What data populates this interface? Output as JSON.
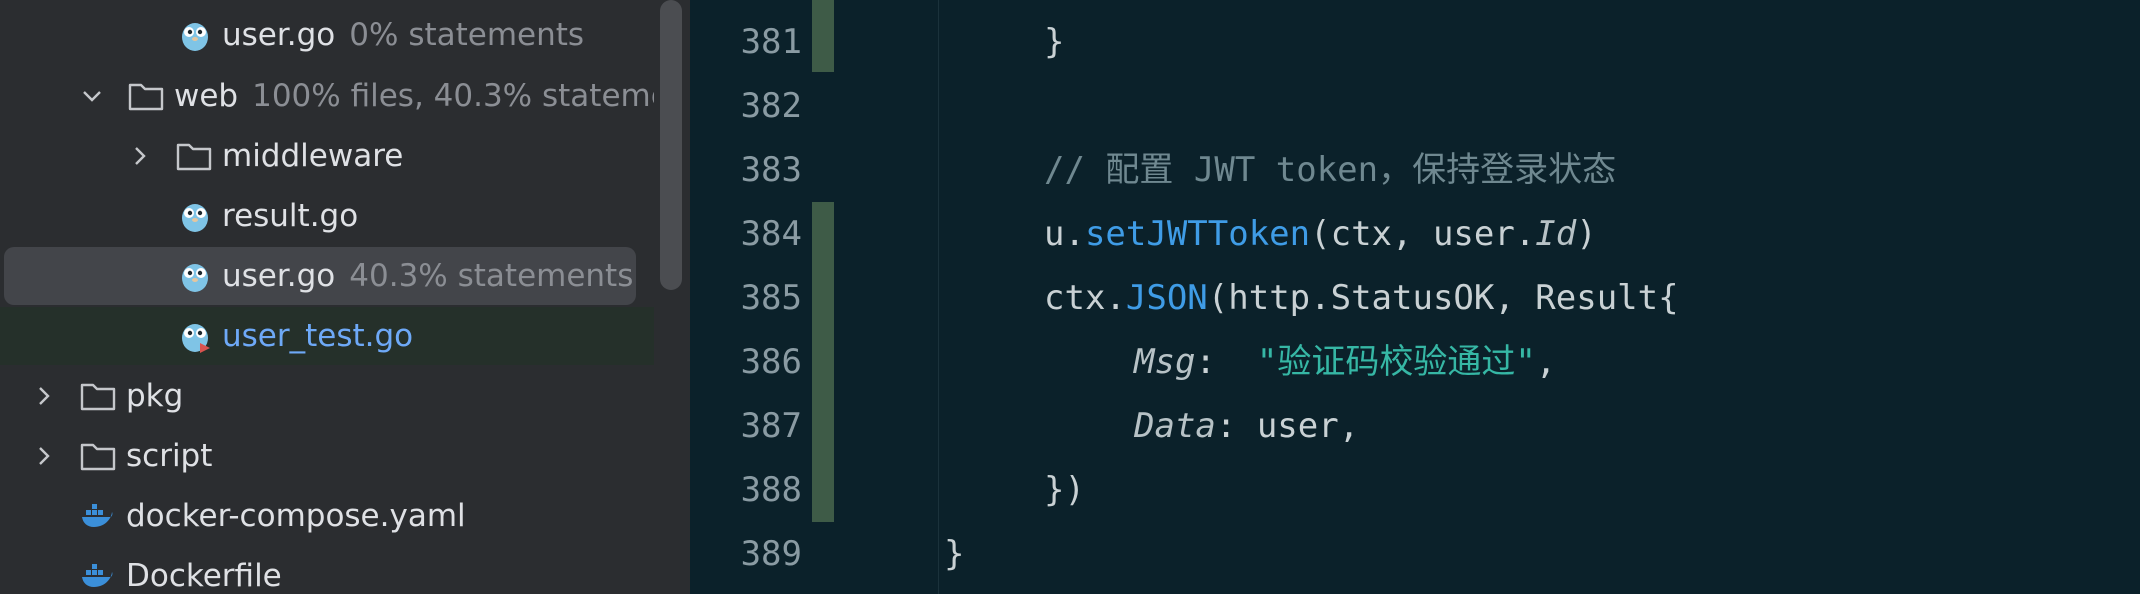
{
  "tree": {
    "rows": [
      {
        "name": "user.go",
        "meta": "0% statements"
      },
      {
        "name": "web",
        "meta": "100% files, 40.3% statemen"
      },
      {
        "name": "middleware",
        "meta": ""
      },
      {
        "name": "result.go",
        "meta": ""
      },
      {
        "name": "user.go",
        "meta": "40.3% statements"
      },
      {
        "name": "user_test.go",
        "meta": ""
      },
      {
        "name": "pkg",
        "meta": ""
      },
      {
        "name": "script",
        "meta": ""
      },
      {
        "name": "docker-compose.yaml",
        "meta": ""
      },
      {
        "name": "Dockerfile",
        "meta": ""
      }
    ]
  },
  "editor": {
    "line_numbers": [
      "381",
      "382",
      "383",
      "384",
      "385",
      "386",
      "387",
      "388",
      "389"
    ],
    "code": {
      "l381": {
        "brace": "}"
      },
      "l383": {
        "comment": "// 配置 JWT token，保持登录状态"
      },
      "l384": {
        "recv": "u.",
        "func": "setJWTToken",
        "args_open": "(ctx, user.",
        "field": "Id",
        "args_close": ")"
      },
      "l385": {
        "recv": "ctx.",
        "func": "JSON",
        "rest": "(http.StatusOK, Result{"
      },
      "l386": {
        "field": "Msg",
        "colon": ":  ",
        "string": "\"验证码校验通过\"",
        "comma": ","
      },
      "l387": {
        "field": "Data",
        "rest": ": user,"
      },
      "l388": {
        "close": "})"
      },
      "l389": {
        "close": "}"
      }
    }
  },
  "colors": {
    "editor_bg": "#0b212a",
    "tree_bg": "#2b2d30",
    "function": "#3f9ce6",
    "string": "#36b7a5",
    "comment": "#6f8890",
    "change_marker": "#3e5b47"
  }
}
